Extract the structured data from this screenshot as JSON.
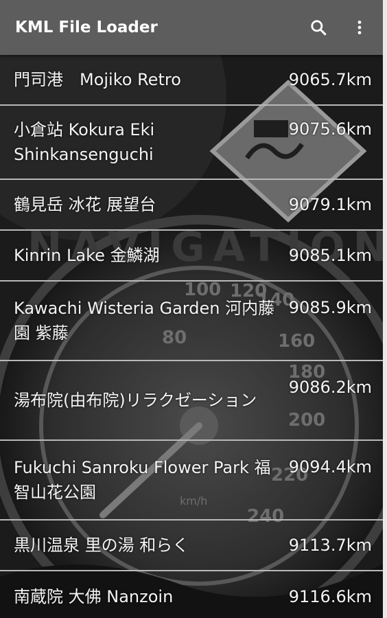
{
  "appbar": {
    "title": "KML File Loader",
    "search_icon": "search-icon",
    "more_icon": "more-vert-icon"
  },
  "background": {
    "watermark": "NAVIGATION",
    "speedometer_ticks": [
      "80",
      "100",
      "120",
      "140",
      "160",
      "180",
      "200",
      "220",
      "240"
    ],
    "unit": "km/h"
  },
  "places": [
    {
      "name": "門司港　Mojiko Retro",
      "distance": "9065.7km"
    },
    {
      "name": "小倉站 Kokura Eki Shinkansenguchi",
      "distance": "9075.6km"
    },
    {
      "name": "鶴見岳 冰花 展望台",
      "distance": "9079.1km"
    },
    {
      "name": "Kinrin Lake 金鱗湖",
      "distance": "9085.1km"
    },
    {
      "name": "Kawachi Wisteria Garden 河内藤園 紫藤",
      "distance": "9085.9km"
    },
    {
      "name": "湯布院(由布院)リラクゼーション",
      "distance": "9086.2km"
    },
    {
      "name": "Fukuchi Sanroku Flower Park 福智山花公園",
      "distance": "9094.4km"
    },
    {
      "name": "黒川温泉 里の湯 和らく",
      "distance": "9113.7km"
    },
    {
      "name": "南蔵院 大佛 Nanzoin",
      "distance": "9116.6km"
    }
  ]
}
